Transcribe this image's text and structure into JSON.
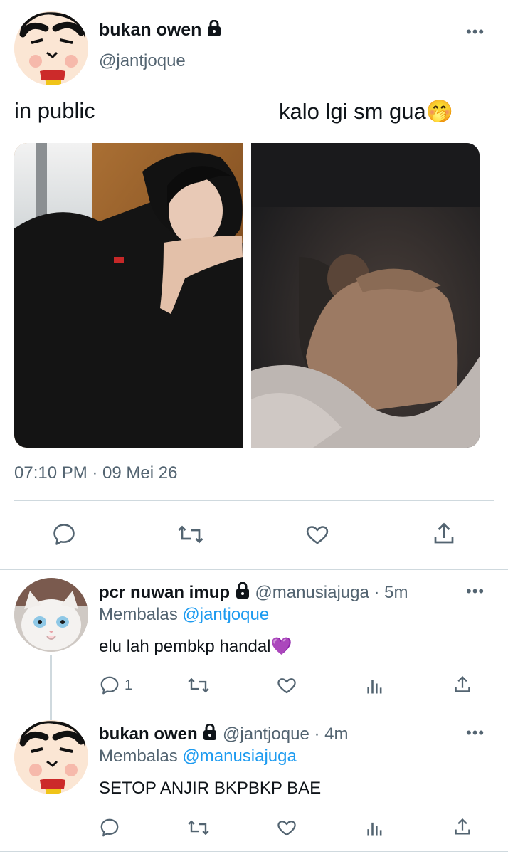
{
  "main_tweet": {
    "display_name": "bukan owen",
    "handle": "@jantjoque",
    "text_left": "in public",
    "text_right": "kalo lgi sm gua",
    "emoji": "🤭",
    "timestamp": "07:10 PM · 09 Mei 26",
    "icons": [
      "reply-icon",
      "retweet-icon",
      "like-icon",
      "share-icon"
    ]
  },
  "replies": [
    {
      "display_name": "pcr nuwan imup",
      "handle": "@manusiajuga",
      "time": "· 5m",
      "replying_label": "Membalas",
      "replying_to": "@jantjoque",
      "text": "elu lah pembkp handal",
      "emoji": "💜",
      "reply_count": "1"
    },
    {
      "display_name": "bukan owen",
      "handle": "@jantjoque",
      "time": "· 4m",
      "replying_label": "Membalas",
      "replying_to": "@manusiajuga",
      "text": "SETOP ANJIR BKPBKP BAE",
      "reply_count": ""
    }
  ],
  "colors": {
    "text": "#0f1419",
    "muted": "#536471",
    "link": "#1d9bf0",
    "divider": "#cfd9de",
    "reply_thread_line": "#cfd9de"
  }
}
